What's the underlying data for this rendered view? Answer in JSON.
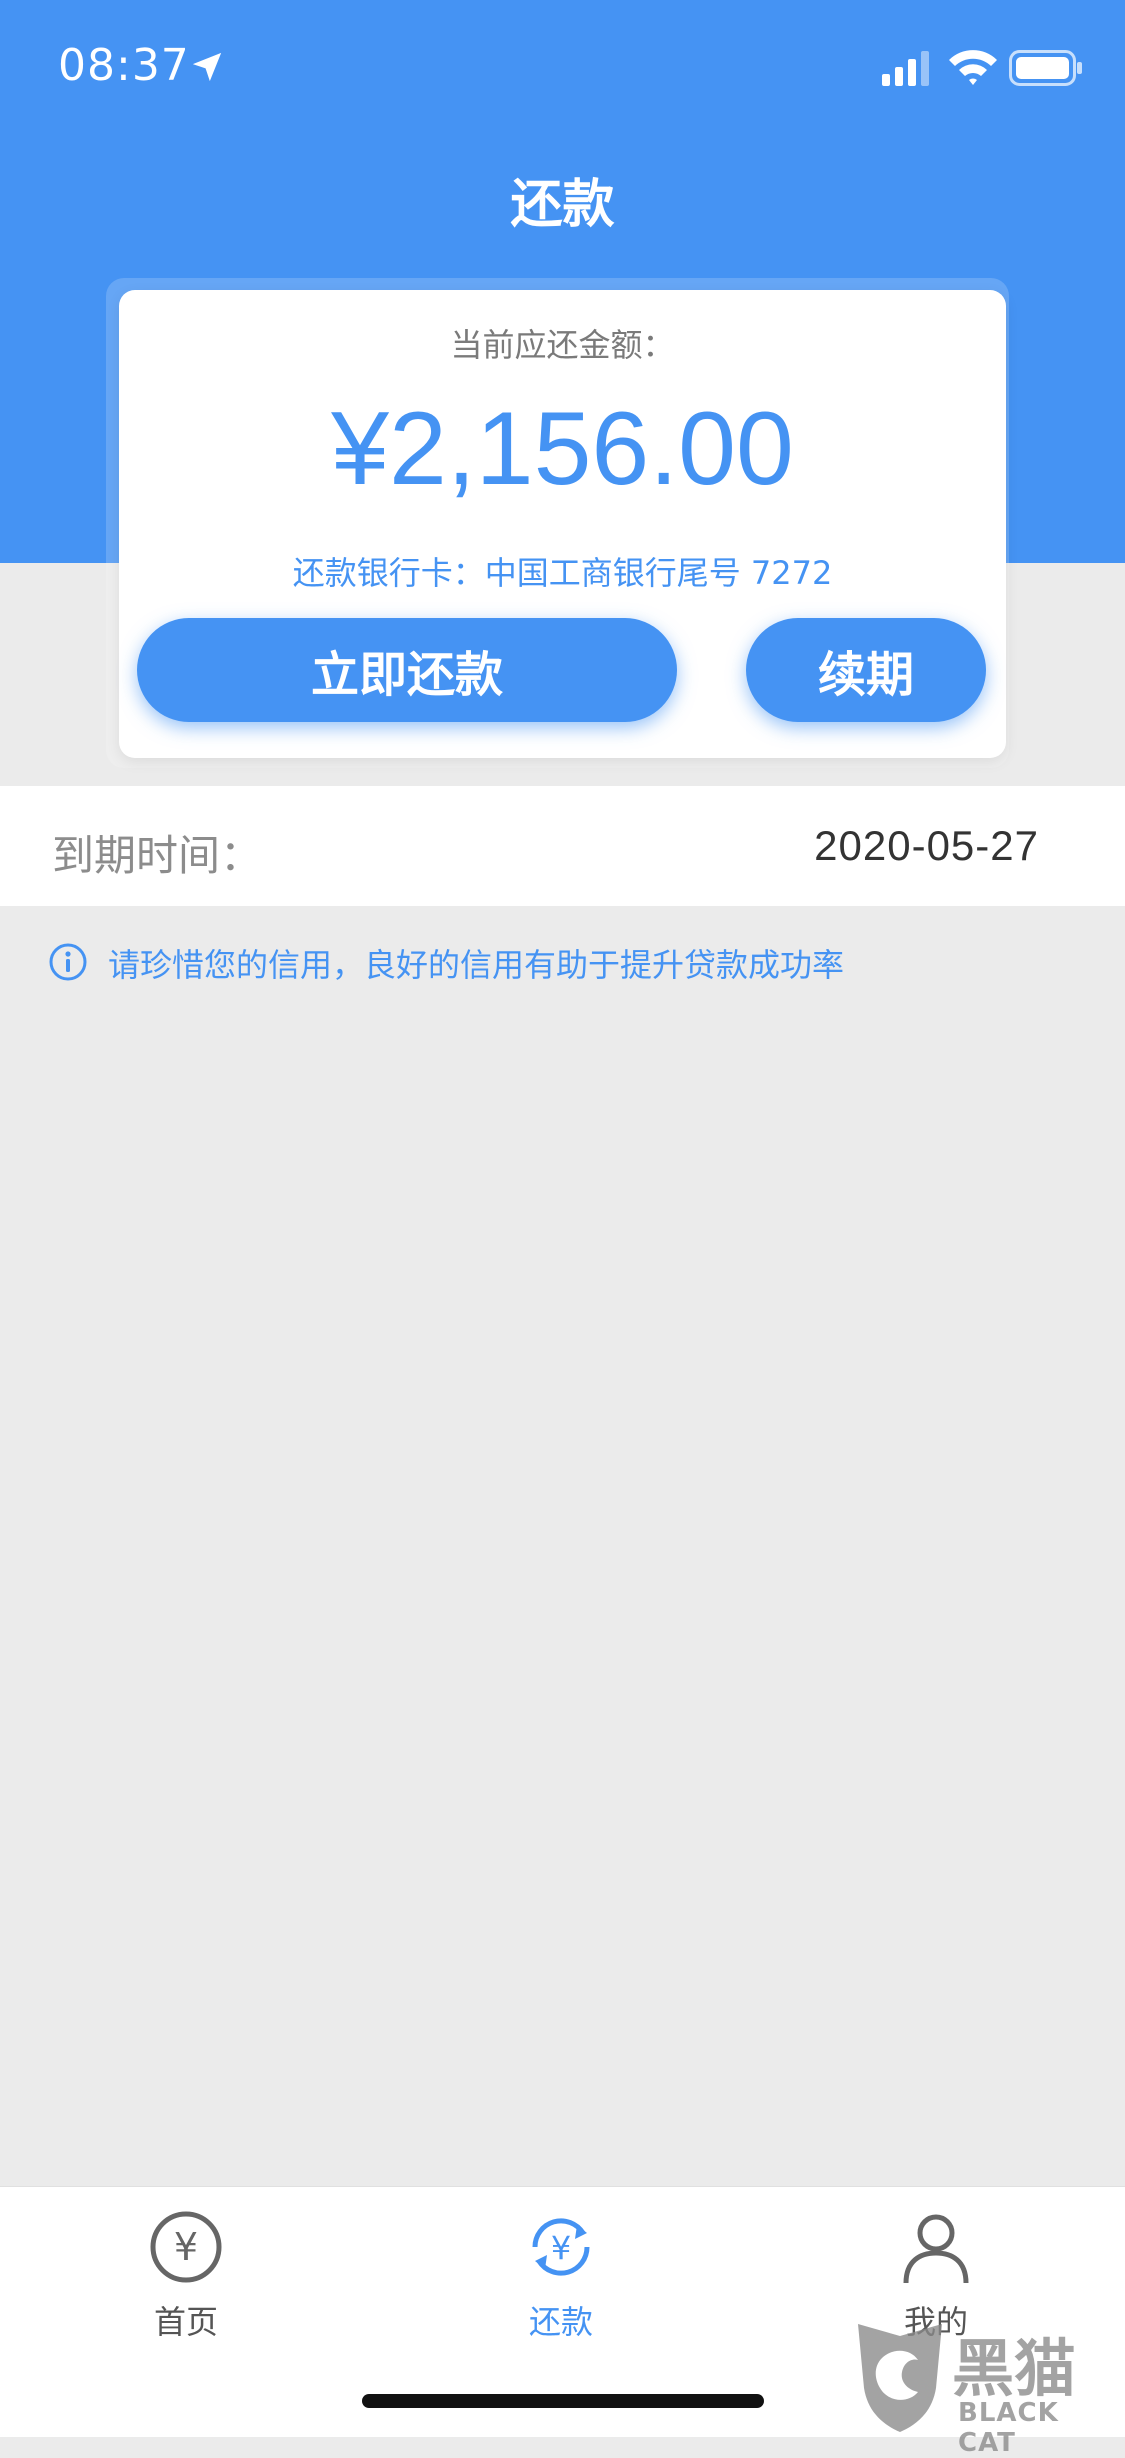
{
  "status_bar": {
    "time": "08:37"
  },
  "header": {
    "title": "还款"
  },
  "card": {
    "label": "当前应还金额：",
    "amount": "¥2,156.00",
    "bank_info": "还款银行卡：中国工商银行尾号 7272",
    "repay_button": "立即还款",
    "renew_button": "续期"
  },
  "due": {
    "label": "到期时间：",
    "value": "2020-05-27"
  },
  "notice": {
    "text": "请珍惜您的信用，良好的信用有助于提升贷款成功率"
  },
  "tabs": [
    {
      "label": "首页",
      "icon": "yen-circle-icon",
      "active": false
    },
    {
      "label": "还款",
      "icon": "yen-refresh-icon",
      "active": true
    },
    {
      "label": "我的",
      "icon": "user-icon",
      "active": false
    }
  ],
  "watermark": {
    "cn": "黑猫",
    "en": "BLACK CAT"
  },
  "colors": {
    "primary": "#4593f3",
    "background": "#ebebeb",
    "card": "#ffffff"
  }
}
